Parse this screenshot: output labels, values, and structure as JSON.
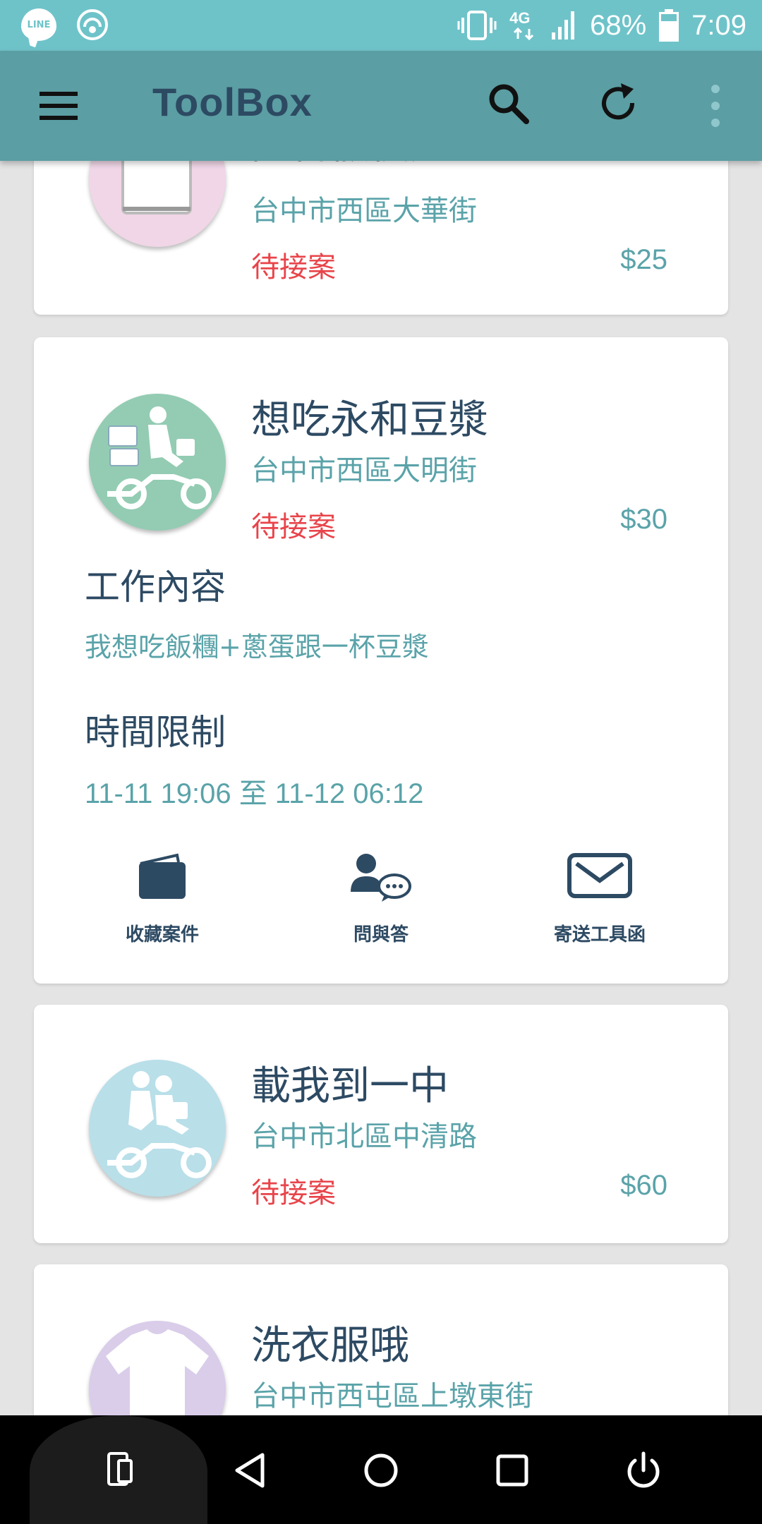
{
  "status_bar": {
    "line_label": "LINE",
    "network": "4G",
    "battery": "68%",
    "time": "7:09"
  },
  "app_bar": {
    "title": "ToolBox",
    "icons": [
      "menu-icon",
      "search-icon",
      "refresh-icon",
      "more-icon"
    ]
  },
  "tasks": [
    {
      "title": "証言假模方",
      "address": "台中市西區大華街",
      "status": "待接案",
      "price": "$25",
      "avatar_color": "#f0d6e6",
      "avatar_icon": "phone-document-icon"
    },
    {
      "title": "想吃永和豆漿",
      "address": "台中市西區大明街",
      "status": "待接案",
      "price": "$30",
      "avatar_color": "#93ccb3",
      "avatar_icon": "delivery-scooter-icon",
      "details": {
        "content_heading": "工作內容",
        "content_text": "我想吃飯糰+蔥蛋跟一杯豆漿",
        "time_heading": "時間限制",
        "time_text": "11-11 19:06 至  11-12 06:12"
      },
      "actions": [
        {
          "label": "收藏案件",
          "icon": "wallet-icon"
        },
        {
          "label": "問與答",
          "icon": "user-chat-icon"
        },
        {
          "label": "寄送工具函",
          "icon": "envelope-icon"
        }
      ]
    },
    {
      "title": "載我到一中",
      "address": "台中市北區中清路",
      "status": "待接案",
      "price": "$60",
      "avatar_color": "#b9dfe9",
      "avatar_icon": "ride-scooter-icon"
    },
    {
      "title": "洗衣服哦",
      "address": "台中市西屯區上墩東街",
      "avatar_color": "#d9cdea",
      "avatar_icon": "tshirt-icon"
    }
  ],
  "nav_bar": {
    "icons": [
      "screen-rotate-icon",
      "back-icon",
      "home-icon",
      "recents-icon",
      "power-icon"
    ]
  },
  "colors": {
    "status_bar": "#6ec3c9",
    "app_bar": "#5b9ea3",
    "title_text": "#2d4a63",
    "accent_text": "#5aa3a9",
    "status_red": "#e8444a",
    "background": "#e4e4e4"
  }
}
